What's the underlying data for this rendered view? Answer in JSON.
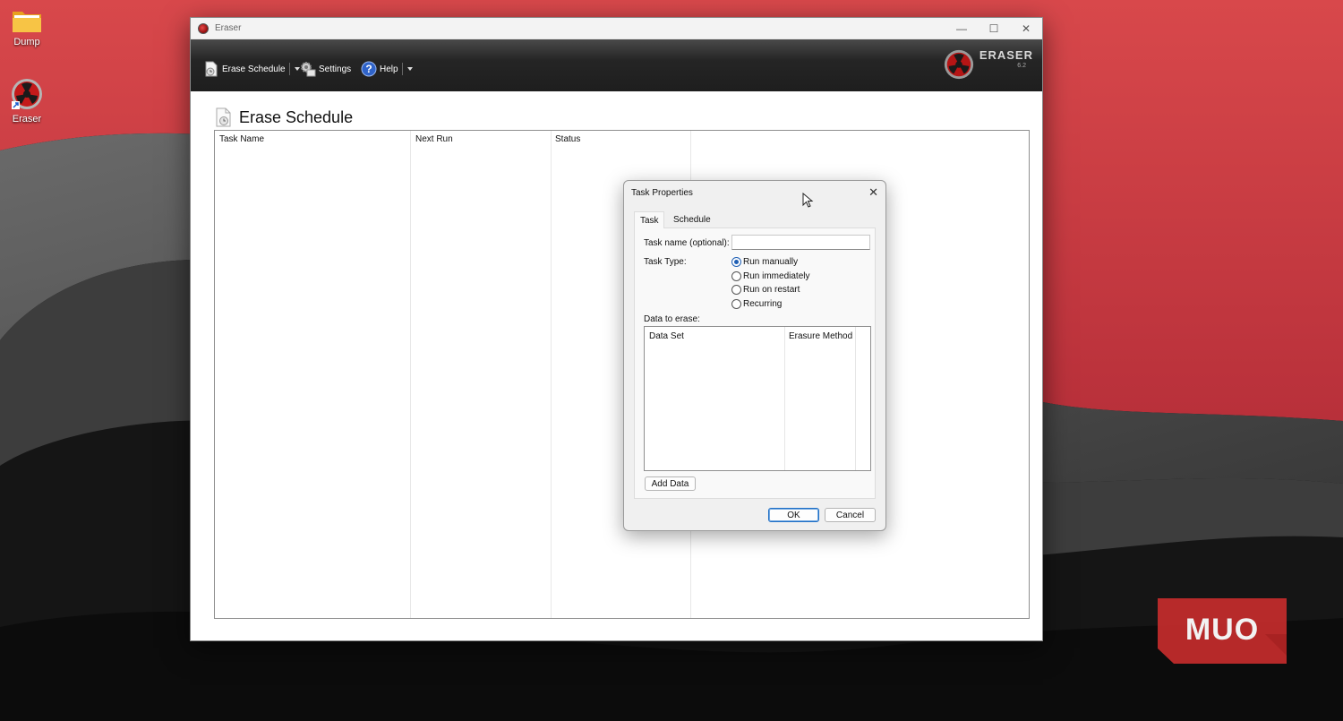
{
  "desktop": {
    "icons": [
      {
        "label": "Dump",
        "icon": "folder-icon"
      },
      {
        "label": "Eraser",
        "icon": "eraser-app-icon"
      }
    ],
    "watermark": "MUO"
  },
  "window": {
    "title": "Eraser",
    "controls": {
      "minimize": "—",
      "maximize": "☐",
      "close": "✕"
    },
    "toolbar": {
      "erase_schedule": "Erase Schedule",
      "settings": "Settings",
      "help": "Help"
    },
    "brand": {
      "name": "ERASER",
      "version": "6.2"
    },
    "page_title": "Erase Schedule",
    "columns": [
      "Task Name",
      "Next Run",
      "Status"
    ]
  },
  "dialog": {
    "title": "Task Properties",
    "close": "✕",
    "tabs": [
      {
        "label": "Task",
        "active": true
      },
      {
        "label": "Schedule",
        "active": false
      }
    ],
    "task_name_label": "Task name (optional):",
    "task_name_value": "",
    "task_type_label": "Task Type:",
    "task_types": [
      {
        "label": "Run manually",
        "checked": true
      },
      {
        "label": "Run immediately",
        "checked": false
      },
      {
        "label": "Run on restart",
        "checked": false
      },
      {
        "label": "Recurring",
        "checked": false
      }
    ],
    "data_to_erase_label": "Data to erase:",
    "list_columns": [
      "Data Set",
      "Erasure Method"
    ],
    "add_data": "Add Data",
    "ok": "OK",
    "cancel": "Cancel"
  },
  "colors": {
    "wallpaper_red": "#d6474a",
    "toolbar_dark": "#1e1e1e",
    "accent_blue": "#1f5fb4"
  }
}
